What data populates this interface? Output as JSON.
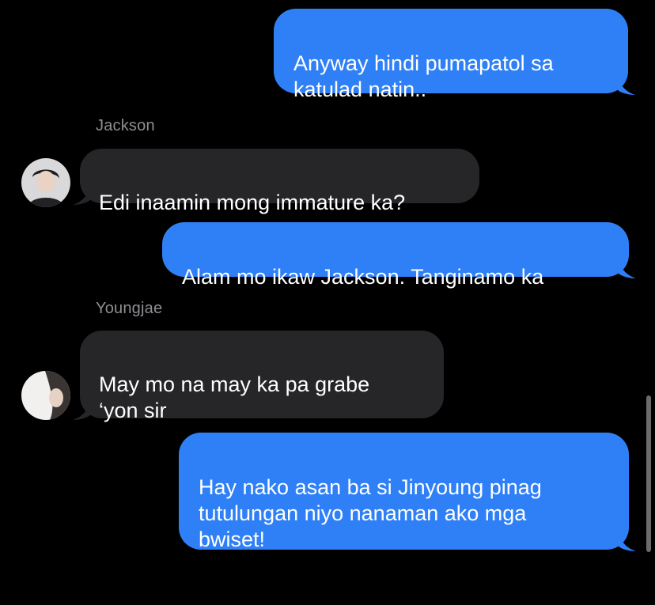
{
  "thread": {
    "messages": [
      {
        "direction": "outgoing",
        "text": "Anyway hindi pumapatol sa\nkatulad natin.."
      },
      {
        "direction": "incoming",
        "sender": "Jackson",
        "text": "Edi inaamin mong immature ka?",
        "avatar_icon": "person-photo-icon"
      },
      {
        "direction": "outgoing",
        "text": "Alam mo ikaw Jackson. Tanginamo ka"
      },
      {
        "direction": "incoming",
        "sender": "Youngjae",
        "text": "May mo na may ka pa grabe\n‘yon sir",
        "avatar_icon": "person-photo-icon"
      },
      {
        "direction": "outgoing",
        "text": "Hay nako asan ba si Jinyoung pinag\ntutulungan niyo nanaman ako mga\nbwiset!"
      }
    ]
  },
  "colors": {
    "background": "#000000",
    "outgoing_bubble": "#2f80f6",
    "incoming_bubble": "#262628",
    "sender_name": "#8e8e93",
    "scrollbar": "#6b6b6e"
  }
}
